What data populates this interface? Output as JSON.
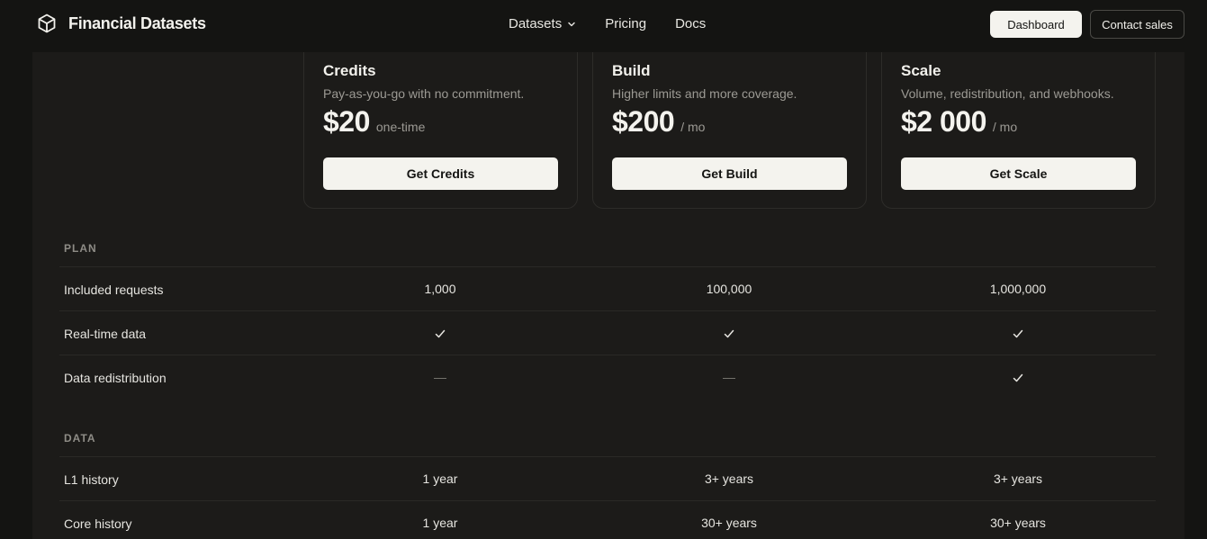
{
  "header": {
    "brand": "Financial Datasets",
    "nav": [
      {
        "label": "Datasets",
        "has_dropdown": true
      },
      {
        "label": "Pricing"
      },
      {
        "label": "Docs"
      }
    ],
    "dashboard_label": "Dashboard",
    "contact_label": "Contact sales"
  },
  "plans": [
    {
      "name": "Credits",
      "description": "Pay-as-you-go with no commitment.",
      "price": "$20",
      "unit": "one-time",
      "cta": "Get Credits"
    },
    {
      "name": "Build",
      "description": "Higher limits and more coverage.",
      "price": "$200",
      "unit": "/ mo",
      "cta": "Get Build"
    },
    {
      "name": "Scale",
      "description": "Volume, redistribution, and webhooks.",
      "price": "$2 000",
      "unit": "/ mo",
      "cta": "Get Scale"
    }
  ],
  "sections": [
    {
      "title": "PLAN",
      "rows": [
        {
          "label": "Included requests",
          "values": [
            "1,000",
            "100,000",
            "1,000,000"
          ]
        },
        {
          "label": "Real-time data",
          "values": [
            "check",
            "check",
            "check"
          ]
        },
        {
          "label": "Data redistribution",
          "values": [
            "—",
            "—",
            "check"
          ]
        }
      ]
    },
    {
      "title": "DATA",
      "rows": [
        {
          "label": "L1 history",
          "values": [
            "1 year",
            "3+ years",
            "3+ years"
          ]
        },
        {
          "label": "Core history",
          "values": [
            "1 year",
            "30+ years",
            "30+ years"
          ]
        }
      ]
    }
  ],
  "icons": {
    "logo": "cube-icon",
    "dropdown": "chevron-down-icon",
    "included": "check-icon"
  },
  "colors": {
    "background": "#141412",
    "panel": "#1c1b19",
    "button": "#f4f3ee",
    "muted_text": "#9c9a94"
  }
}
